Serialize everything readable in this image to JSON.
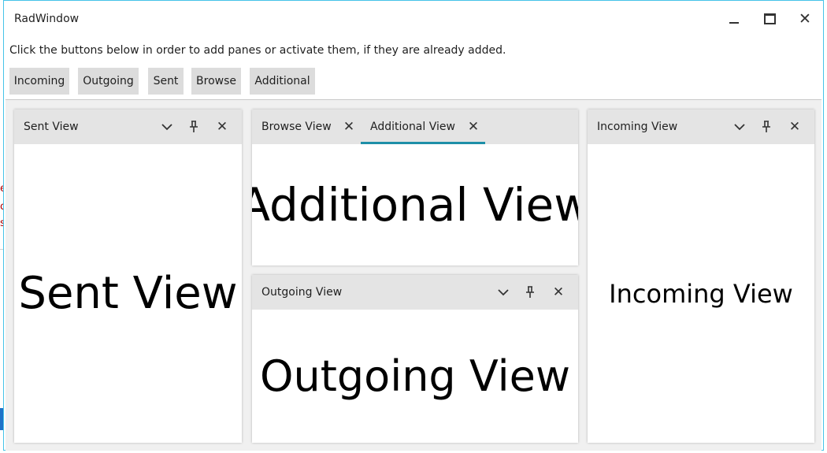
{
  "window": {
    "title": "RadWindow"
  },
  "instruction": "Click the buttons below in order to add panes or activate them, if they are already added.",
  "buttons": {
    "incoming": "Incoming",
    "outgoing": "Outgoing",
    "sent": "Sent",
    "browse": "Browse",
    "additional": "Additional"
  },
  "panes": {
    "sent": {
      "header": "Sent View",
      "body": "Sent View"
    },
    "tab_group": {
      "tabs": [
        {
          "label": "Browse View",
          "selected": false
        },
        {
          "label": "Additional View",
          "selected": true
        }
      ],
      "body": "Additional View"
    },
    "outgoing": {
      "header": "Outgoing View",
      "body": "Outgoing View"
    },
    "incoming": {
      "header": "Incoming View",
      "body": "Incoming View"
    }
  },
  "colors": {
    "window_border": "#46c3e8",
    "button_bg": "#dcdcdc",
    "header_bg": "#e4e4e4",
    "tab_accent": "#1e8fa8"
  }
}
